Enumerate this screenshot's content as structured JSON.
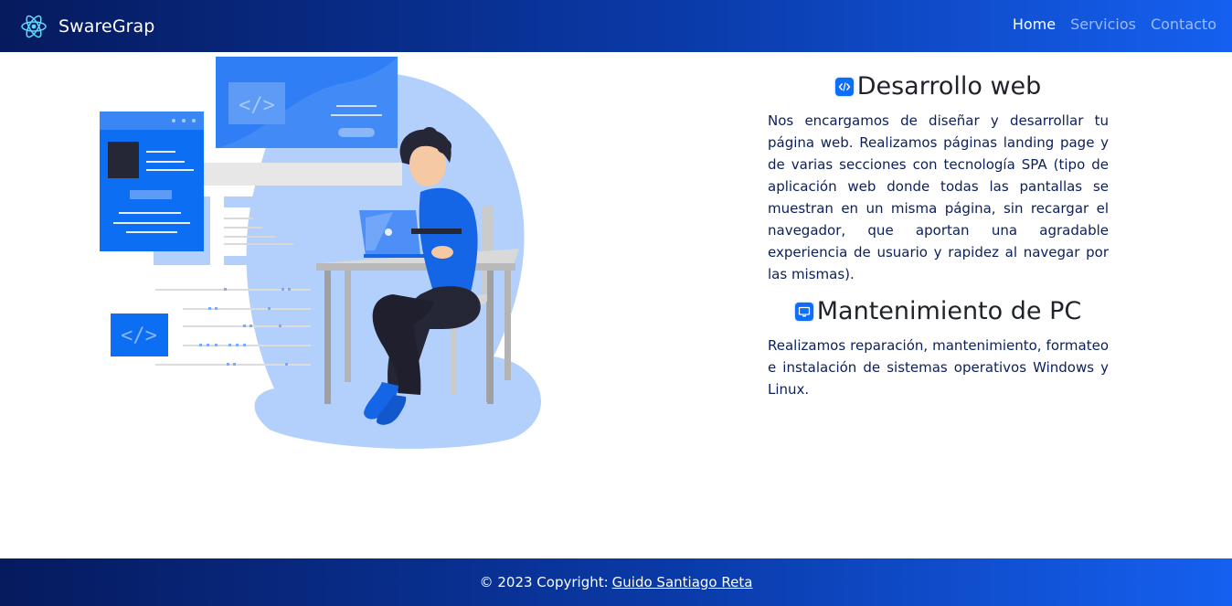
{
  "navbar": {
    "brand": "SwareGrap",
    "brand_icon": "react-atom-icon",
    "links": [
      {
        "label": "Home",
        "active": true
      },
      {
        "label": "Servicios",
        "active": false
      },
      {
        "label": "Contacto",
        "active": false
      }
    ]
  },
  "hero": {
    "illustration": "developer-with-laptop-illustration"
  },
  "services": [
    {
      "icon": "code-square-icon",
      "title": "Desarrollo web",
      "text": "Nos encargamos de diseñar y desarrollar tu página web. Realizamos páginas landing page y de varias secciones con tecnología SPA (tipo de aplicación web donde todas las pantallas se muestran en un misma página, sin recargar el navegador, que aportan una agradable experiencia de usuario y rapidez al navegar por las mismas)."
    },
    {
      "icon": "display-icon",
      "title": "Mantenimiento de PC",
      "text": "Realizamos reparación, mantenimiento, formateo e instalación de sistemas operativos Windows y Linux."
    }
  ],
  "footer": {
    "prefix": "© 2023 Copyright:",
    "author_link": "Guido Santiago Reta"
  },
  "colors": {
    "accent": "#0d6efd",
    "nav_gradient_start": "#061a5e",
    "nav_gradient_end": "#1560f0",
    "text_dark": "#0b1f5c"
  }
}
